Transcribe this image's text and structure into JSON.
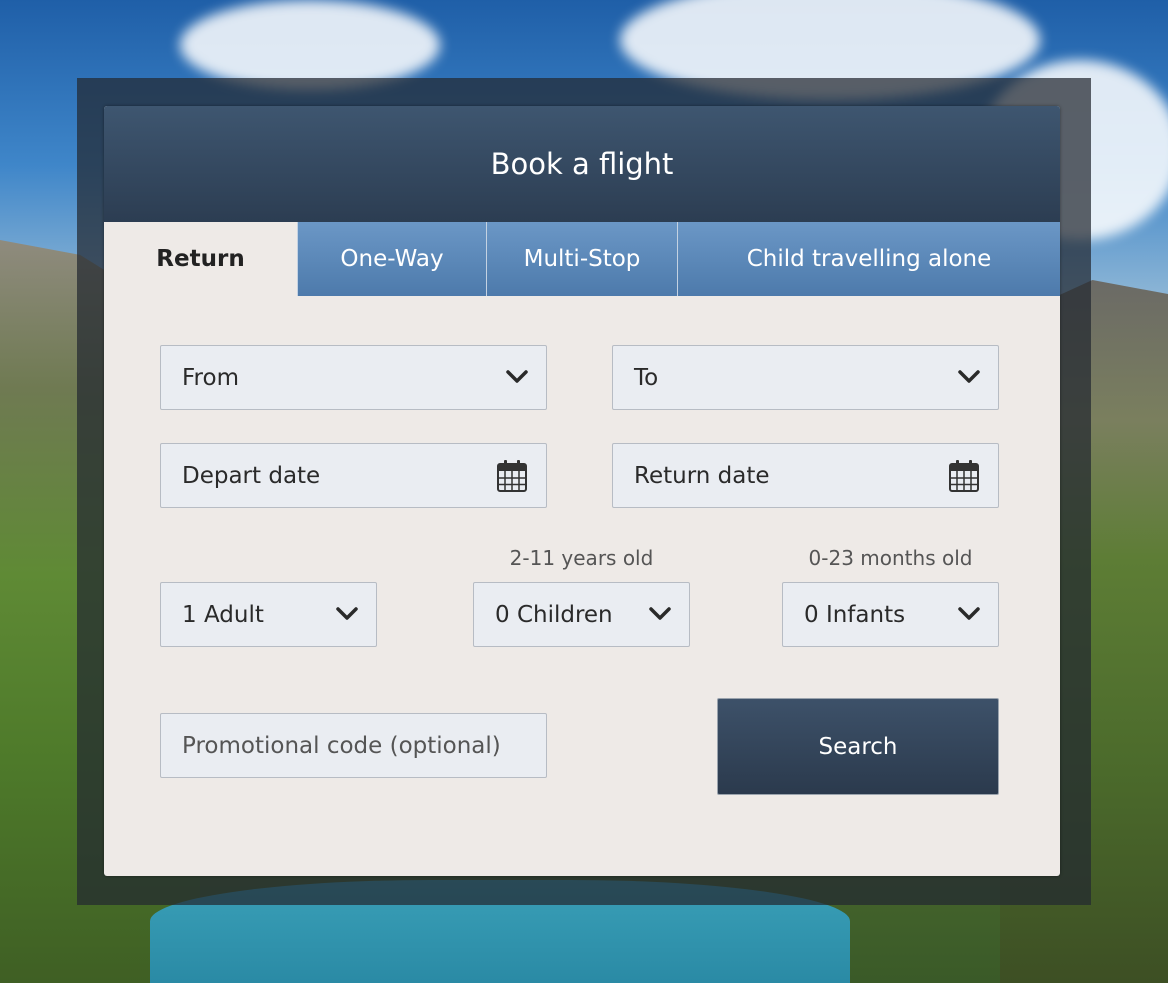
{
  "header": {
    "title": "Book a flight"
  },
  "tabs": [
    {
      "label": "Return",
      "active": true
    },
    {
      "label": "One-Way",
      "active": false
    },
    {
      "label": "Multi-Stop",
      "active": false
    },
    {
      "label": "Child travelling alone",
      "active": false
    }
  ],
  "form": {
    "from": {
      "value": "From",
      "icon": "chevron-down-icon"
    },
    "to": {
      "value": "To",
      "icon": "chevron-down-icon"
    },
    "depart_date": {
      "value": "Depart date",
      "icon": "calendar-icon"
    },
    "return_date": {
      "value": "Return date",
      "icon": "calendar-icon"
    },
    "adults": {
      "value": "1 Adult"
    },
    "children": {
      "value": "0 Children",
      "hint": "2-11 years old"
    },
    "infants": {
      "value": "0 Infants",
      "hint": "0-23 months old"
    },
    "promo": {
      "placeholder": "Promotional code (optional)"
    },
    "search_label": "Search"
  },
  "colors": {
    "header_bg": "#2c3d52",
    "tab_bg": "#5b88b8",
    "card_bg": "#eeeae7",
    "field_bg": "#eaedf2",
    "button_bg": "#33455b"
  }
}
